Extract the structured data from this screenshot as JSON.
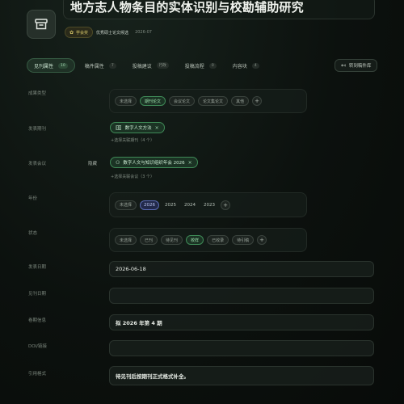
{
  "header": {
    "title": "地方志人物条目的实体识别与校勘辅助研究",
    "award_label": "学会奖",
    "badge_text": "优秀硕士论文候选",
    "date": "2026-07"
  },
  "tabs": [
    {
      "label": "见刊属性",
      "count": "10"
    },
    {
      "label": "稿件属性",
      "count": "7"
    },
    {
      "label": "投稿建议",
      "count": "行政"
    },
    {
      "label": "投稿流程",
      "count": "0"
    },
    {
      "label": "内容块",
      "count": "4"
    }
  ],
  "goto_button": "转到稿件库",
  "rows": {
    "result_type": {
      "label": "成果类型",
      "chips": [
        "未选择",
        "期刊论文",
        "会议论文",
        "论文集论文",
        "其他"
      ],
      "selected": 1
    },
    "journal": {
      "label": "发表期刊",
      "tag": "数字人文方法",
      "hint": "+选择关联期刊（4 个）"
    },
    "conference": {
      "label": "发表会议",
      "sub_label": "隐藏",
      "tag": "数字人文与知识组织年会 2026",
      "hint": "+选择关联会议（3 个）"
    },
    "year": {
      "label": "年份",
      "chips": [
        "未选择",
        "2026",
        "2025",
        "2024",
        "2023"
      ],
      "selected": 1
    },
    "status": {
      "label": "状态",
      "chips": [
        "未选择",
        "已刊",
        "待见刊",
        "校样",
        "已收录",
        "待引稿"
      ],
      "selected": 3
    },
    "publish_date": {
      "label": "发表日期",
      "value": "2026-06-18"
    },
    "online_date": {
      "label": "见刊日期",
      "value": ""
    },
    "issue_info": {
      "label": "卷期信息",
      "value": "拟 2026 年第 4 期"
    },
    "doi": {
      "label": "DOI/链接",
      "value": ""
    },
    "citation": {
      "label": "引用格式",
      "value": "待见刊后按期刊正式格式补全。"
    }
  },
  "colors": {
    "accent_green": "#3f8a57",
    "accent_blue": "#5a6bb4",
    "award_gold": "#d9c96a"
  }
}
